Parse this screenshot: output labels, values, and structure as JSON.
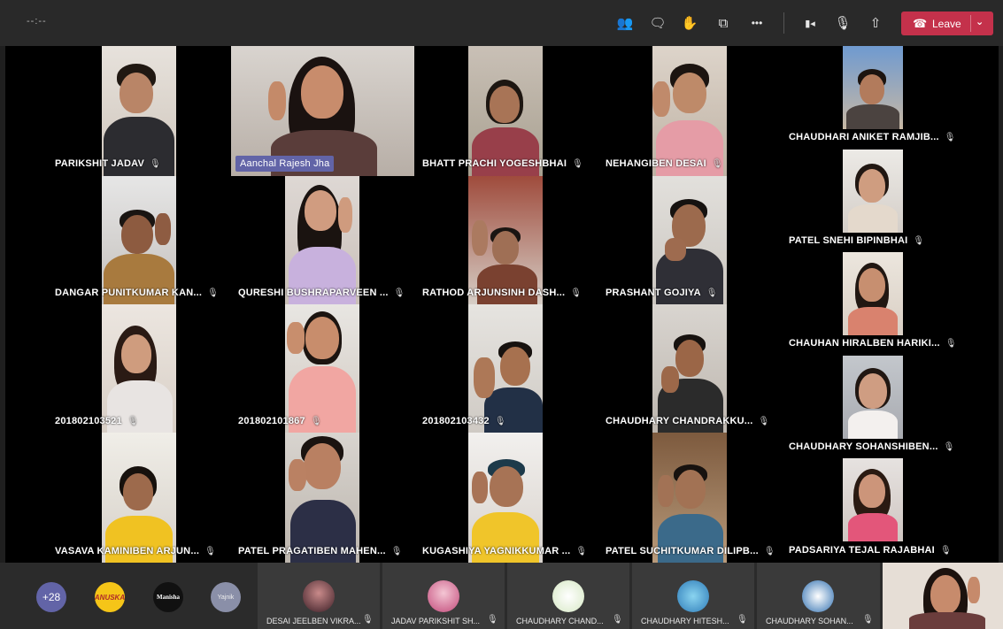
{
  "topbar": {
    "timer": "--:--",
    "icons": [
      "participants-icon",
      "chat-icon",
      "raise-hand-icon",
      "rooms-icon",
      "more-icon",
      "camera-icon",
      "mic-icon",
      "share-icon"
    ],
    "glyphs": {
      "participants": "👥",
      "chat": "🗨",
      "hand": "✋",
      "rooms": "⧉",
      "more": "•••",
      "camera": "▮◂",
      "mic": "🎙",
      "share": "⇧"
    },
    "leave_label": "Leave",
    "leave_color": "#c4314b"
  },
  "mic_glyph": "🎙",
  "participants": [
    {
      "name": "PARIKSHIT JADAV"
    },
    {
      "name": "Aanchal Rajesh Jha"
    },
    {
      "name": "BHATT PRACHI YOGESHBHAI"
    },
    {
      "name": "NEHANGIBEN DESAI"
    },
    {
      "name": "CHAUDHARI ANIKET RAMJIB..."
    },
    {
      "name": "DANGAR PUNITKUMAR KAN..."
    },
    {
      "name": "QURESHI BUSHRAPARVEEN ..."
    },
    {
      "name": "RATHOD ARJUNSINH DASH..."
    },
    {
      "name": "PRASHANT GOJIYA"
    },
    {
      "name": "PATEL SNEHI BIPINBHAI"
    },
    {
      "name": "201802103521"
    },
    {
      "name": "201802101867"
    },
    {
      "name": "201802103432"
    },
    {
      "name": "CHAUDHARY CHANDRAKKU..."
    },
    {
      "name": "CHAUHAN HIRALBEN HARIKI..."
    },
    {
      "name": "VASAVA KAMINIBEN ARJUN..."
    },
    {
      "name": "PATEL PRAGATIBEN MAHEN..."
    },
    {
      "name": "KUGASHIYA YAGNIKKUMAR ..."
    },
    {
      "name": "PATEL SUCHITKUMAR DILIPB..."
    },
    {
      "name": "CHAUDHARY SOHANSHIBEN..."
    },
    {
      "name": "PADSARIYA TEJAL RAJABHAI"
    }
  ],
  "bottom": {
    "overflow_count": "+28",
    "avatars": [
      {
        "label": "ANUSKA",
        "color": "#f5c518"
      },
      {
        "label": "Manisha",
        "color": "#111111"
      },
      {
        "label": "Yajnik",
        "color": "#8a8fa8"
      }
    ],
    "tiles": [
      {
        "name": "DESAI JEELBEN VIKRA..."
      },
      {
        "name": "JADAV PARIKSHIT SH..."
      },
      {
        "name": "CHAUDHARY CHAND..."
      },
      {
        "name": "CHAUDHARY HITESH..."
      },
      {
        "name": "CHAUDHARY SOHAN..."
      }
    ]
  },
  "colors": {
    "accent": "#6264a7",
    "stage_bg": "#000000",
    "bar_bg": "#292929"
  }
}
